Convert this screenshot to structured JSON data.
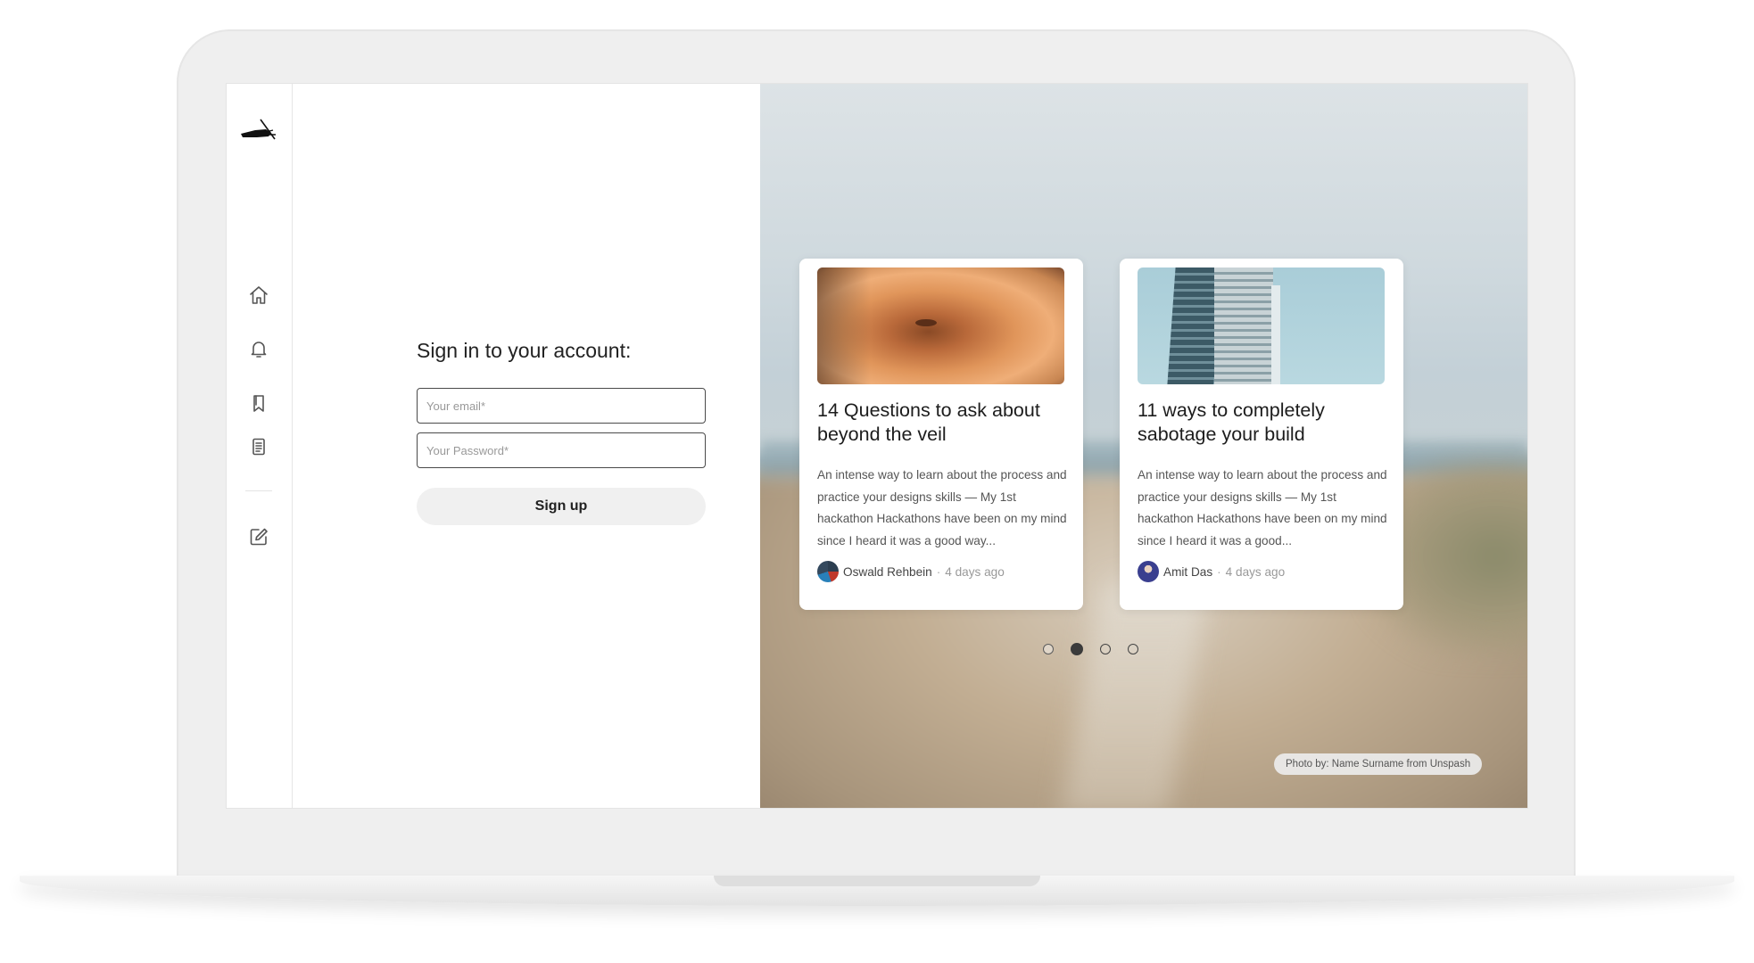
{
  "sidebar": {
    "logo": "hand-writing-logo",
    "items": [
      {
        "name": "home",
        "icon": "home-icon"
      },
      {
        "name": "notifications",
        "icon": "bell-icon"
      },
      {
        "name": "bookmarks",
        "icon": "bookmark-icon"
      },
      {
        "name": "documents",
        "icon": "document-icon"
      },
      {
        "name": "write",
        "icon": "edit-icon"
      }
    ]
  },
  "signin": {
    "title": "Sign in to your account:",
    "email_placeholder": "Your email*",
    "password_placeholder": "Your Password*",
    "button_label": "Sign up"
  },
  "cards": [
    {
      "title": "14 Questions to ask about beyond the veil",
      "excerpt": "An intense way to learn about the process and practice your designs skills — My 1st hackathon Hackathons have been on my mind since I heard it was a good way...",
      "author": "Oswald Rehbein",
      "separator": "·",
      "time": "4 days ago"
    },
    {
      "title": "11 ways to completely sabotage your build",
      "excerpt": "An intense way to learn about the process and practice your designs skills — My 1st hackathon Hackathons have been on my mind since I heard it was a good...",
      "author": "Amit Das",
      "separator": "·",
      "time": "4 days ago"
    }
  ],
  "carousel": {
    "total": 4,
    "active_index": 1
  },
  "photo_credit": "Photo by: Name Surname from Unspash",
  "colors": {
    "button_bg": "#f0f0f0",
    "text": "#222222",
    "border": "#4a4a4a"
  }
}
